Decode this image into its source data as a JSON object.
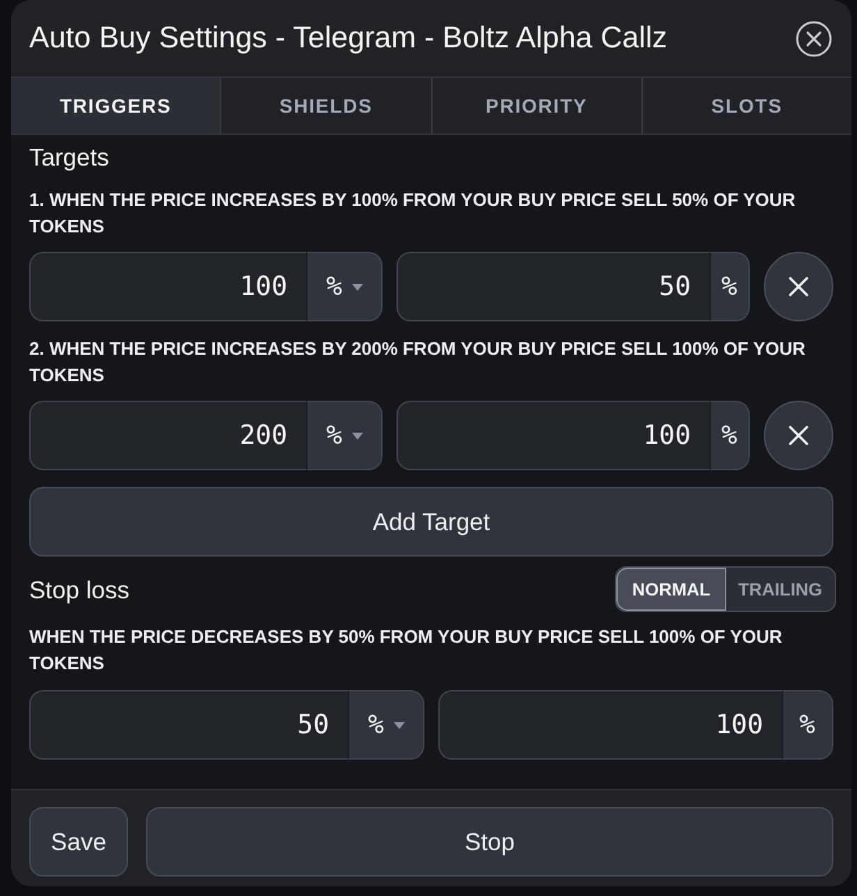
{
  "dialog": {
    "title": "Auto Buy Settings - Telegram - Boltz Alpha Callz"
  },
  "tabs": [
    {
      "label": "TRIGGERS",
      "selected": true
    },
    {
      "label": "SHIELDS",
      "selected": false
    },
    {
      "label": "PRIORITY",
      "selected": false
    },
    {
      "label": "SLOTS",
      "selected": false
    }
  ],
  "targets": {
    "heading": "Targets",
    "items": [
      {
        "description": "1. WHEN THE PRICE INCREASES BY 100% FROM YOUR BUY PRICE SELL 50% OF YOUR TOKENS",
        "trigger": {
          "value": "100",
          "unit": "%",
          "kind": "dropdown"
        },
        "sell": {
          "value": "50",
          "unit": "%",
          "kind": "plain"
        }
      },
      {
        "description": "2. WHEN THE PRICE INCREASES BY 200% FROM YOUR BUY PRICE SELL 100% OF YOUR TOKENS",
        "trigger": {
          "value": "200",
          "unit": "%",
          "kind": "dropdown"
        },
        "sell": {
          "value": "100",
          "unit": "%",
          "kind": "plain"
        }
      }
    ]
  },
  "add_target_button": "Add Target",
  "stop_loss": {
    "heading": "Stop loss",
    "modes": [
      {
        "label": "NORMAL",
        "selected": true
      },
      {
        "label": "TRAILING",
        "selected": false
      }
    ],
    "description": "WHEN THE PRICE DECREASES BY 50% FROM YOUR BUY PRICE SELL 100% OF YOUR TOKENS",
    "trigger": {
      "value": "50",
      "unit": "%",
      "kind": "dropdown"
    },
    "sell": {
      "value": "100",
      "unit": "%",
      "kind": "plain"
    }
  },
  "footer": {
    "buttons": [
      {
        "label": "Save",
        "kind": "secondary"
      },
      {
        "label": "Stop",
        "kind": "primary"
      }
    ]
  }
}
